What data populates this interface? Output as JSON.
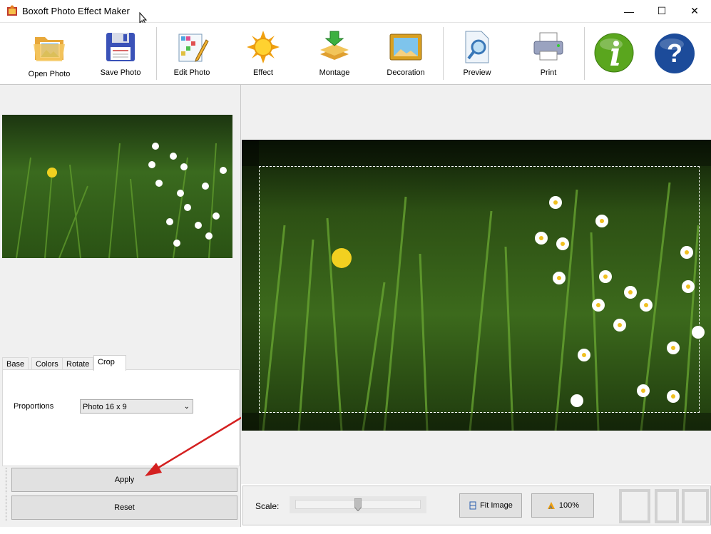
{
  "window": {
    "title": "Boxoft Photo Effect Maker",
    "controls": [
      "—",
      "☐",
      "✕"
    ]
  },
  "toolbar": {
    "items": [
      {
        "label": "Open Photo",
        "icon": "folder-photo-icon"
      },
      {
        "label": "Save Photo",
        "icon": "floppy-disk-icon"
      },
      {
        "label": "Edit Photo",
        "icon": "grid-pencil-icon"
      },
      {
        "label": "Effect",
        "icon": "sun-icon"
      },
      {
        "label": "Montage",
        "icon": "stack-arrow-icon"
      },
      {
        "label": "Decoration",
        "icon": "framed-picture-icon"
      },
      {
        "label": "Preview",
        "icon": "magnifier-page-icon"
      },
      {
        "label": "Print",
        "icon": "printer-icon"
      }
    ],
    "info_icon": "info-icon",
    "help_icon": "help-icon"
  },
  "tabs": [
    "Base",
    "Colors",
    "Rotate",
    "Crop"
  ],
  "active_tab": "Crop",
  "crop": {
    "proportions_label": "Proportions",
    "proportions_value": "Photo 16 x 9"
  },
  "buttons": {
    "apply": "Apply",
    "reset": "Reset"
  },
  "bottom": {
    "scale_label": "Scale:",
    "fit_image": "Fit Image",
    "zoom_100": "100%"
  },
  "colors": {
    "accent_arrow": "#d42020",
    "info_green": "#5aa61e",
    "help_blue": "#1c4b9a"
  }
}
